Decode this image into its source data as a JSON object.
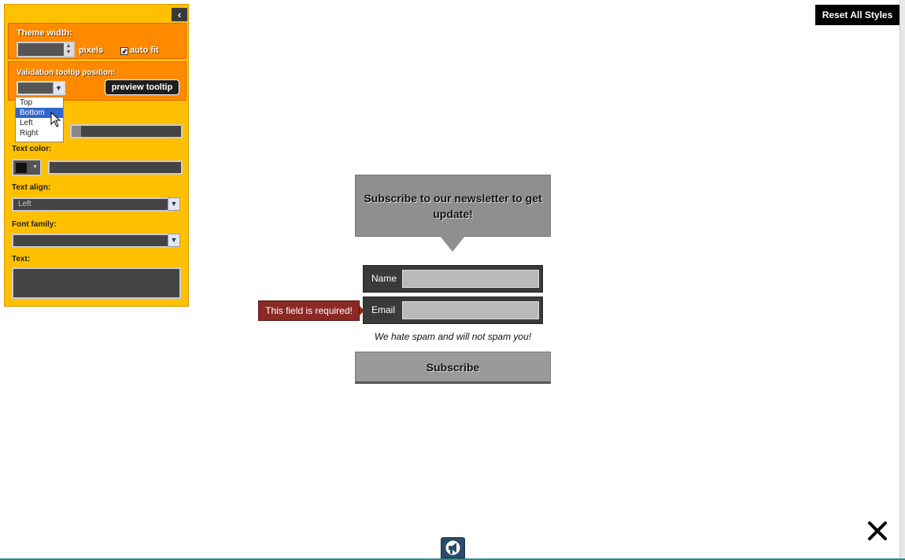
{
  "panel": {
    "collapse_icon": "chevron-left-icon",
    "theme_width_label": "Theme width:",
    "theme_width_value": "",
    "pixels_label": "pixels",
    "auto_fit_label": "auto fit",
    "auto_fit_checked": true,
    "tooltip_position_label": "Validation tooltip position:",
    "preview_tooltip_label": "preview tooltip",
    "tooltip_options": [
      "Top",
      "Bottom",
      "Left",
      "Right"
    ],
    "tooltip_selected": "Bottom",
    "text_color_label": "Text color:",
    "text_align_label": "Text align:",
    "text_align_value": "Left",
    "font_family_label": "Font family:",
    "text_label": "Text:",
    "accent_color": "#ffc000",
    "section_color": "#ff8a00"
  },
  "reset_all_label": "Reset All Styles",
  "widget": {
    "headline": "Subscribe to our newsletter to get update!",
    "name_label": "Name",
    "email_label": "Email",
    "tooltip_text": "This field is required!",
    "tooltip_color": "#8b2a24",
    "spam_note": "We hate spam and will not spam you!",
    "subscribe_label": "Subscribe"
  },
  "bottom": {
    "tab_icon": "megaphone-icon",
    "close_icon": "close-icon"
  }
}
